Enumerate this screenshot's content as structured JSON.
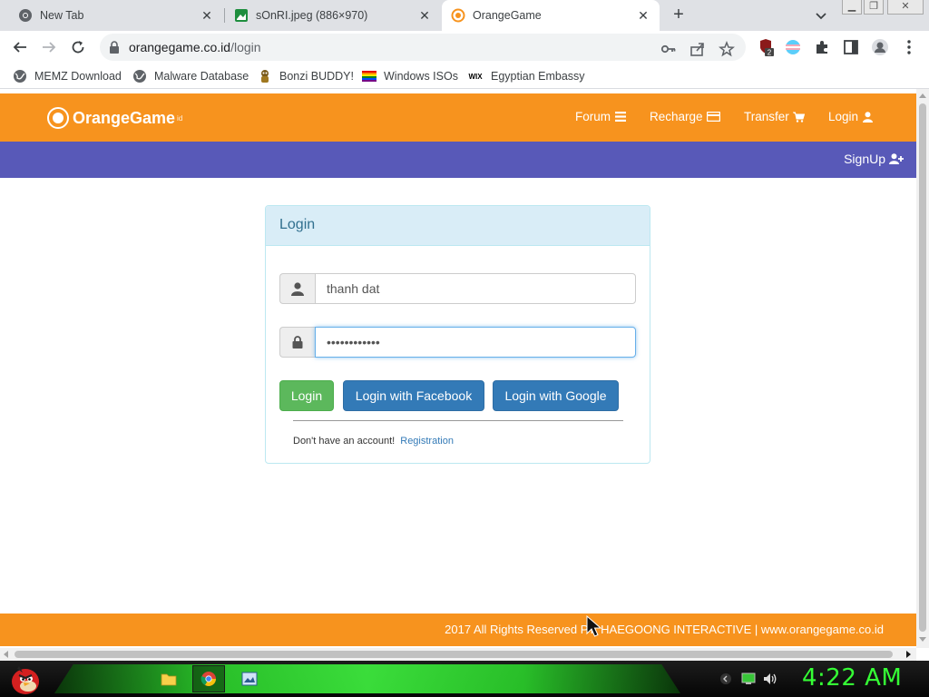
{
  "browser": {
    "tabs": [
      {
        "title": "New Tab",
        "icon": "chrome-icon"
      },
      {
        "title": "sOnRI.jpeg (886×970)",
        "icon": "image-icon"
      },
      {
        "title": "OrangeGame",
        "icon": "orange-circle-icon",
        "active": true
      }
    ],
    "new_tab_label": "+",
    "url_host": "orangegame.co.id",
    "url_path": "/login",
    "extension_badge": "2",
    "bookmarks": [
      {
        "label": "MEMZ Download",
        "icon": "globe-icon"
      },
      {
        "label": "Malware Database",
        "icon": "globe-icon"
      },
      {
        "label": "Bonzi BUDDY!",
        "icon": "bonzi-icon"
      },
      {
        "label": "Windows ISOs",
        "icon": "rainbow-flag-icon"
      },
      {
        "label": "Egyptian Embassy",
        "icon": "wix-icon"
      }
    ],
    "wix_text": "WIX"
  },
  "site": {
    "brand": "OrangeGame",
    "brand_suffix": "id",
    "nav": [
      {
        "label": "Forum",
        "icon": "bars-icon"
      },
      {
        "label": "Recharge",
        "icon": "credit-card-icon"
      },
      {
        "label": "Transfer",
        "icon": "cart-icon"
      },
      {
        "label": "Login",
        "icon": "user-icon"
      }
    ],
    "signup_label": "SignUp",
    "colors": {
      "orange": "#f7931e",
      "purple": "#5859b8",
      "green": "#5cb85c",
      "blue": "#337ab7"
    }
  },
  "login": {
    "title": "Login",
    "username_value": "thanh dat",
    "password_value": "••••••••••••",
    "login_button": "Login",
    "facebook_button": "Login with Facebook",
    "google_button": "Login with Google",
    "no_account_text": "Don't have an account!",
    "registration_link": "Registration"
  },
  "footer": {
    "text": "2017 All Rights Reserved PT. HAEGOONG INTERACTIVE | www.orangegame.co.id"
  },
  "taskbar": {
    "clock": "4:22 AM"
  }
}
